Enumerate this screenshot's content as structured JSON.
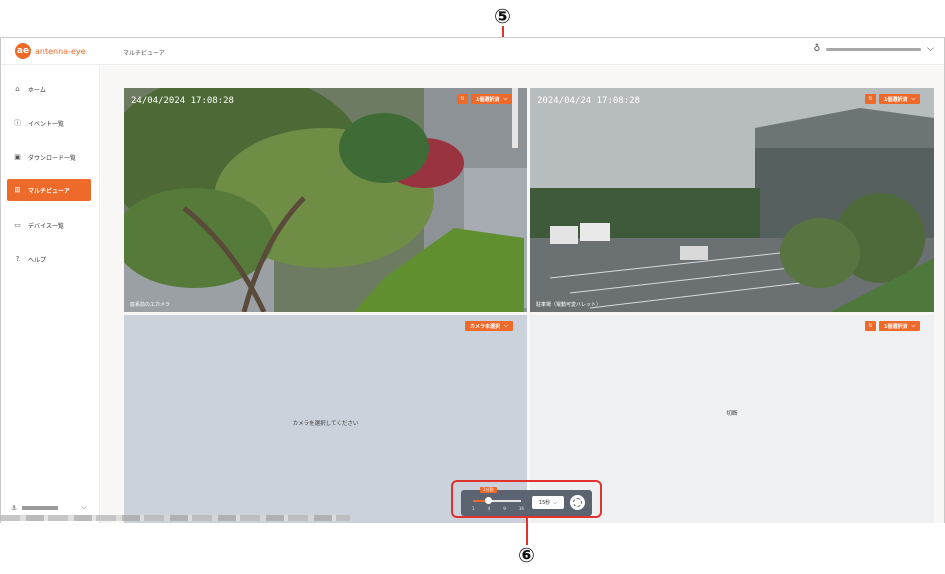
{
  "app": {
    "logo_mark": "ae",
    "logo_text": "antenna-eye",
    "breadcrumb": "マルチビューア"
  },
  "user": {
    "icon": "person-icon",
    "chevron": "⌵"
  },
  "sidebar": {
    "items": [
      {
        "label": "ホーム",
        "icon": "home-icon",
        "glyph": "⌂",
        "active": false
      },
      {
        "label": "イベント一覧",
        "icon": "info-icon",
        "glyph": "ⓘ",
        "active": false
      },
      {
        "label": "ダウンロード一覧",
        "icon": "image-icon",
        "glyph": "▣",
        "active": false
      },
      {
        "label": "マルチビューア",
        "icon": "grid-icon",
        "glyph": "⊞",
        "active": true
      },
      {
        "label": "デバイス一覧",
        "icon": "camera-icon",
        "glyph": "▭",
        "active": false
      },
      {
        "label": "ヘルプ",
        "icon": "help-icon",
        "glyph": "?",
        "active": false
      }
    ],
    "bottom_icon": "anchor-icon",
    "bottom_chevron": "⌵"
  },
  "tiles": [
    {
      "timestamp": "24/04/2024 17:08:28",
      "camera_name": "庭系前のエカメラ",
      "select_label": "1個選択済",
      "has_swap": true
    },
    {
      "timestamp": "2024/04/24 17:08:28",
      "camera_name": "駐車場（電動可変バレット）",
      "select_label": "1個選択済",
      "has_swap": true
    },
    {
      "message": "カメラを選択してください",
      "select_label": "カメラ未選択",
      "has_swap": false
    },
    {
      "message": "切断",
      "select_label": "1個選択済",
      "has_swap": true
    }
  ],
  "controls": {
    "slider_badge": "1分割",
    "slider_ticks": [
      "1",
      "4",
      "9",
      "16"
    ],
    "slider_position": 0.33,
    "interval_label": "15秒",
    "accent": "#ee6a2b"
  },
  "callouts": {
    "top_number": "⑤",
    "bottom_number": "⑥"
  }
}
